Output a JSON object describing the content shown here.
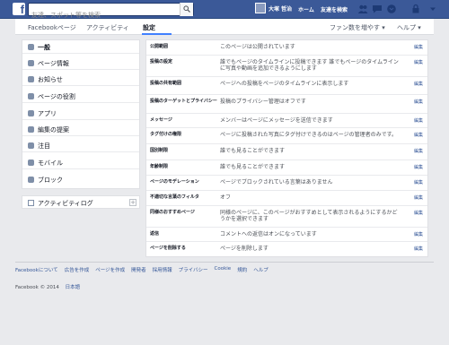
{
  "topbar": {
    "logo": "f",
    "search_placeholder": "友達、スポット等を検索",
    "user_name": "大塚 哲治",
    "nav": [
      "ホーム",
      "友達を検索"
    ],
    "icons": [
      "friend-requests-icon",
      "messages-icon",
      "notifications-icon",
      "lock-icon",
      "settings-arrow-icon"
    ]
  },
  "pagehead": {
    "tabs": [
      "Facebookページ",
      "アクティビティ",
      "設定"
    ],
    "active_tab": "設定",
    "right": [
      "ファン数を増やす ▾",
      "ヘルプ ▾"
    ]
  },
  "sidebar": {
    "items": [
      {
        "label": "一般",
        "icon": "gear-icon"
      },
      {
        "label": "ページ情報",
        "icon": "info-icon"
      },
      {
        "label": "お知らせ",
        "icon": "globe-icon"
      },
      {
        "label": "ページの役割",
        "icon": "person-icon"
      },
      {
        "label": "アプリ",
        "icon": "apps-icon"
      },
      {
        "label": "編集の提案",
        "icon": "pencil-icon"
      },
      {
        "label": "注目",
        "icon": "star-icon"
      },
      {
        "label": "モバイル",
        "icon": "mobile-icon"
      },
      {
        "label": "ブロック",
        "icon": "block-icon"
      }
    ],
    "activity_log": "アクティビティログ",
    "activity_log_plus": "+"
  },
  "settings": {
    "edit_label": "編集",
    "rows": [
      {
        "label": "公開範囲",
        "value": "このページは公開されています"
      },
      {
        "label": "投稿の設定",
        "value": "誰でもページのタイムラインに投稿できます 誰でもページのタイムラインに写真や動画を追加できるようにします"
      },
      {
        "label": "投稿の共有範囲",
        "value": "ページへの投稿をページのタイムラインに表示します"
      },
      {
        "label": "投稿のターゲットとプライバシー",
        "value": "投稿のプライバシー管理はオフです"
      },
      {
        "label": "メッセージ",
        "value": "メンバーはページにメッセージを送信できます"
      },
      {
        "label": "タグ付けの権限",
        "value": "ページに投稿された写真にタグ付けできるのはページの管理者のみです。"
      },
      {
        "label": "国別制限",
        "value": "誰でも見ることができます"
      },
      {
        "label": "年齢制限",
        "value": "誰でも見ることができます"
      },
      {
        "label": "ページのモデレーション",
        "value": "ページでブロックされている言葉はありません"
      },
      {
        "label": "不適切な言葉のフィルタ",
        "value": "オフ"
      },
      {
        "label": "同様のおすすめページ",
        "value": "同様のページに、このページがおすすめとして表示されるようにするかどうかを選択できます"
      },
      {
        "label": "返信",
        "value": "コメントへの返信はオンになっています"
      },
      {
        "label": "ページを削除する",
        "value": "ページを削除します"
      }
    ]
  },
  "footer": {
    "links": [
      "Facebookについて",
      "広告を作成",
      "ページを作成",
      "開発者",
      "採用情報",
      "プライバシー",
      "Cookie",
      "規約",
      "ヘルプ"
    ],
    "copyright": "Facebook © 2014",
    "language": "日本語"
  },
  "colors": {
    "topbar": "#3b5998",
    "link": "#365899",
    "background": "#e9eaed"
  }
}
